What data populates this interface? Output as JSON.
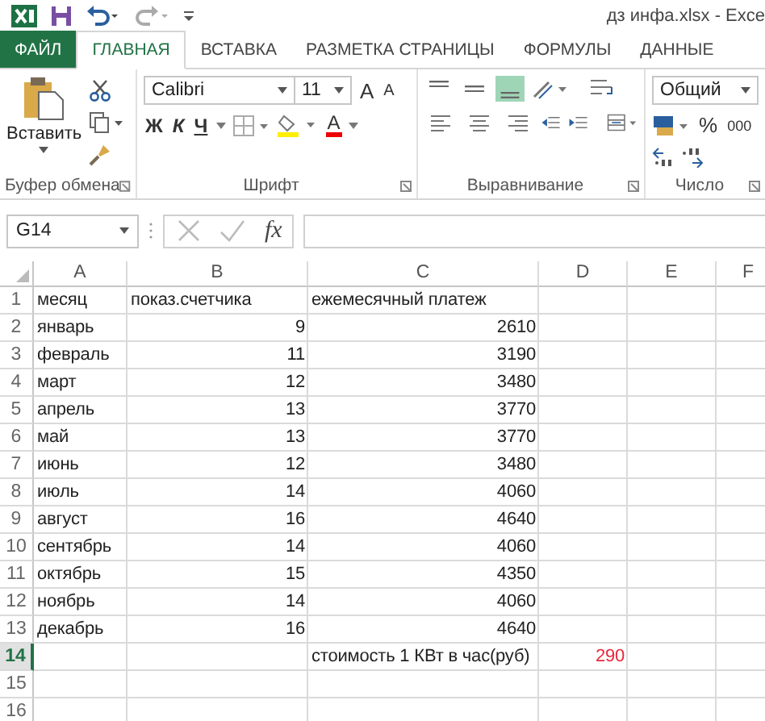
{
  "window": {
    "title": "дз инфа.xlsx - Exce"
  },
  "tabs": [
    {
      "label": "ФАЙЛ",
      "kind": "file",
      "selected": false
    },
    {
      "label": "ГЛАВНАЯ",
      "kind": "tab",
      "selected": true
    },
    {
      "label": "ВСТАВКА",
      "kind": "tab",
      "selected": false
    },
    {
      "label": "РАЗМЕТКА СТРАНИЦЫ",
      "kind": "tab",
      "selected": false
    },
    {
      "label": "ФОРМУЛЫ",
      "kind": "tab",
      "selected": false
    },
    {
      "label": "ДАННЫЕ",
      "kind": "tab",
      "selected": false
    }
  ],
  "ribbon": {
    "clipboard": {
      "paste": "Вставить",
      "label": "Буфер обмена"
    },
    "font": {
      "name": "Calibri",
      "size": "11",
      "grow": "A",
      "shrink": "A",
      "bold": "Ж",
      "italic": "К",
      "underline": "Ч",
      "font_color": "A",
      "label": "Шрифт"
    },
    "alignment": {
      "vertical": [
        {
          "kind": "top",
          "selected": false
        },
        {
          "kind": "middle",
          "selected": false
        },
        {
          "kind": "bottom",
          "selected": true
        }
      ],
      "horizontal": [
        {
          "kind": "left",
          "selected": false
        },
        {
          "kind": "center",
          "selected": false
        },
        {
          "kind": "right",
          "selected": false
        }
      ],
      "label": "Выравнивание"
    },
    "number": {
      "format": "Общий",
      "percent": "%",
      "thousands": "000",
      "label": "Число"
    }
  },
  "formula_bar": {
    "name_box": "G14",
    "function": "fx"
  },
  "sheet": {
    "columns": [
      {
        "label": "A"
      },
      {
        "label": "B"
      },
      {
        "label": "C"
      },
      {
        "label": "D"
      },
      {
        "label": "E"
      },
      {
        "label": "F"
      }
    ],
    "rows": [
      {
        "number": "1",
        "selected": false,
        "col_a": {
          "text": "месяц",
          "kind": "text"
        },
        "col_b": {
          "text": "показ.счетчика",
          "kind": "text"
        },
        "col_c": {
          "text": "ежемесячный платеж",
          "kind": "text"
        }
      },
      {
        "number": "2",
        "selected": false,
        "col_a": {
          "text": "январь",
          "kind": "text"
        },
        "col_b": {
          "text": "9",
          "kind": "number"
        },
        "col_c": {
          "text": "2610",
          "kind": "number"
        }
      },
      {
        "number": "3",
        "selected": false,
        "col_a": {
          "text": "февраль",
          "kind": "text"
        },
        "col_b": {
          "text": "11",
          "kind": "number"
        },
        "col_c": {
          "text": "3190",
          "kind": "number"
        }
      },
      {
        "number": "4",
        "selected": false,
        "col_a": {
          "text": "март",
          "kind": "text"
        },
        "col_b": {
          "text": "12",
          "kind": "number"
        },
        "col_c": {
          "text": "3480",
          "kind": "number"
        }
      },
      {
        "number": "5",
        "selected": false,
        "col_a": {
          "text": "апрель",
          "kind": "text"
        },
        "col_b": {
          "text": "13",
          "kind": "number"
        },
        "col_c": {
          "text": "3770",
          "kind": "number"
        }
      },
      {
        "number": "6",
        "selected": false,
        "col_a": {
          "text": "май",
          "kind": "text"
        },
        "col_b": {
          "text": "13",
          "kind": "number"
        },
        "col_c": {
          "text": "3770",
          "kind": "number"
        }
      },
      {
        "number": "7",
        "selected": false,
        "col_a": {
          "text": "июнь",
          "kind": "text"
        },
        "col_b": {
          "text": "12",
          "kind": "number"
        },
        "col_c": {
          "text": "3480",
          "kind": "number"
        }
      },
      {
        "number": "8",
        "selected": false,
        "col_a": {
          "text": "июль",
          "kind": "text"
        },
        "col_b": {
          "text": "14",
          "kind": "number"
        },
        "col_c": {
          "text": "4060",
          "kind": "number"
        }
      },
      {
        "number": "9",
        "selected": false,
        "col_a": {
          "text": "август",
          "kind": "text"
        },
        "col_b": {
          "text": "16",
          "kind": "number"
        },
        "col_c": {
          "text": "4640",
          "kind": "number"
        }
      },
      {
        "number": "10",
        "selected": false,
        "col_a": {
          "text": "сентябрь",
          "kind": "text"
        },
        "col_b": {
          "text": "14",
          "kind": "number"
        },
        "col_c": {
          "text": "4060",
          "kind": "number"
        }
      },
      {
        "number": "11",
        "selected": false,
        "col_a": {
          "text": "октябрь",
          "kind": "text"
        },
        "col_b": {
          "text": "15",
          "kind": "number"
        },
        "col_c": {
          "text": "4350",
          "kind": "number"
        }
      },
      {
        "number": "12",
        "selected": false,
        "col_a": {
          "text": "ноябрь",
          "kind": "text"
        },
        "col_b": {
          "text": "14",
          "kind": "number"
        },
        "col_c": {
          "text": "4060",
          "kind": "number"
        }
      },
      {
        "number": "13",
        "selected": false,
        "col_a": {
          "text": "декабрь",
          "kind": "text"
        },
        "col_b": {
          "text": "16",
          "kind": "number"
        },
        "col_c": {
          "text": "4640",
          "kind": "number"
        }
      },
      {
        "number": "14",
        "selected": true,
        "col_c": {
          "text": "стоимость 1 КВт в час(руб)",
          "kind": "text"
        },
        "col_d": {
          "text": "290",
          "kind": "number",
          "color": "#e8283c"
        }
      },
      {
        "number": "15",
        "selected": false
      },
      {
        "number": "16",
        "selected": false
      }
    ]
  }
}
